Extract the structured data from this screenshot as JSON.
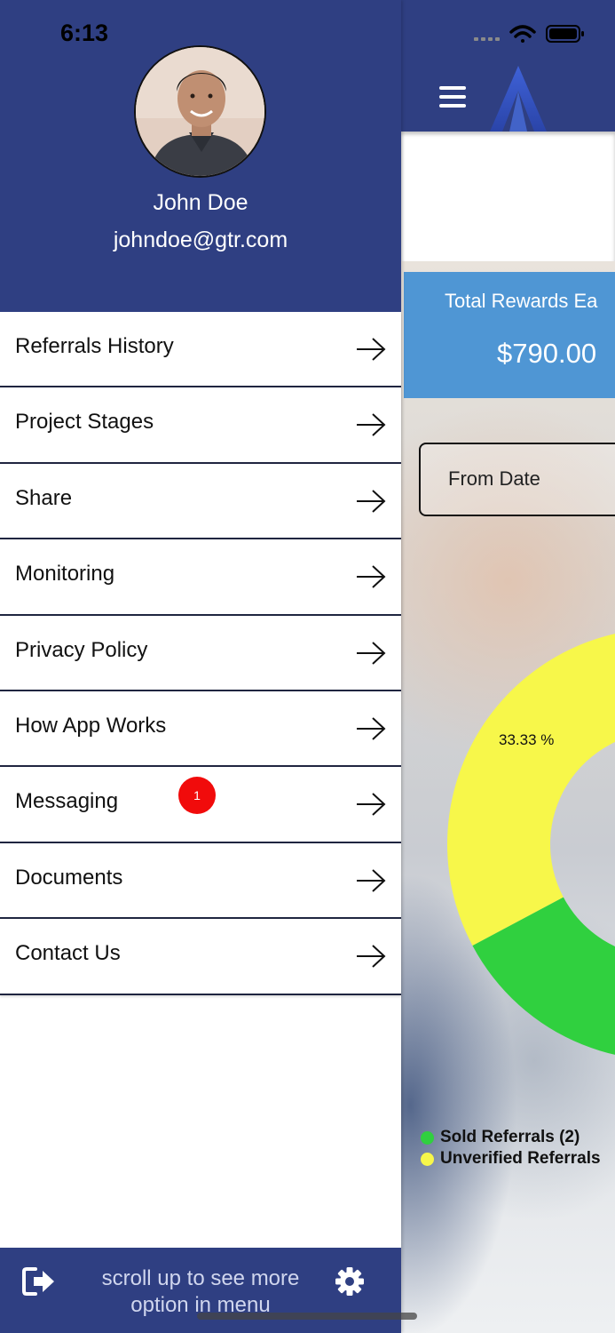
{
  "status_bar": {
    "time": "6:13"
  },
  "profile": {
    "name": "John Doe",
    "email": "johndoe@gtr.com"
  },
  "menu": {
    "items": [
      {
        "label": "Referrals History"
      },
      {
        "label": "Project Stages"
      },
      {
        "label": "Share"
      },
      {
        "label": "Monitoring"
      },
      {
        "label": "Privacy Policy"
      },
      {
        "label": "How App Works"
      },
      {
        "label": "Messaging",
        "badge": "1"
      },
      {
        "label": "Documents"
      },
      {
        "label": "Contact Us"
      }
    ]
  },
  "footer": {
    "hint": "scroll up to see more option in menu"
  },
  "background_screen": {
    "rewards_label": "Total Rewards Ea",
    "rewards_value": "$790.00",
    "from_date_placeholder": "From Date",
    "chart_percent_label": "33.33 %",
    "legend": [
      {
        "label": "Sold Referrals (2)",
        "color": "#30d03f"
      },
      {
        "label": "Unverified Referrals",
        "color": "#f7f74a"
      }
    ]
  },
  "chart_data": {
    "type": "pie",
    "labels": [
      "Sold Referrals (2)",
      "Unverified Referrals"
    ],
    "data_labels": [
      "33.33 %"
    ],
    "values": [
      66.67,
      33.33
    ],
    "colors": [
      "#30d03f",
      "#f7f74a"
    ],
    "donut": true
  },
  "colors": {
    "brand_blue": "#2f3f82",
    "card_blue": "#4f96d4",
    "badge_red": "#f10b0b"
  }
}
